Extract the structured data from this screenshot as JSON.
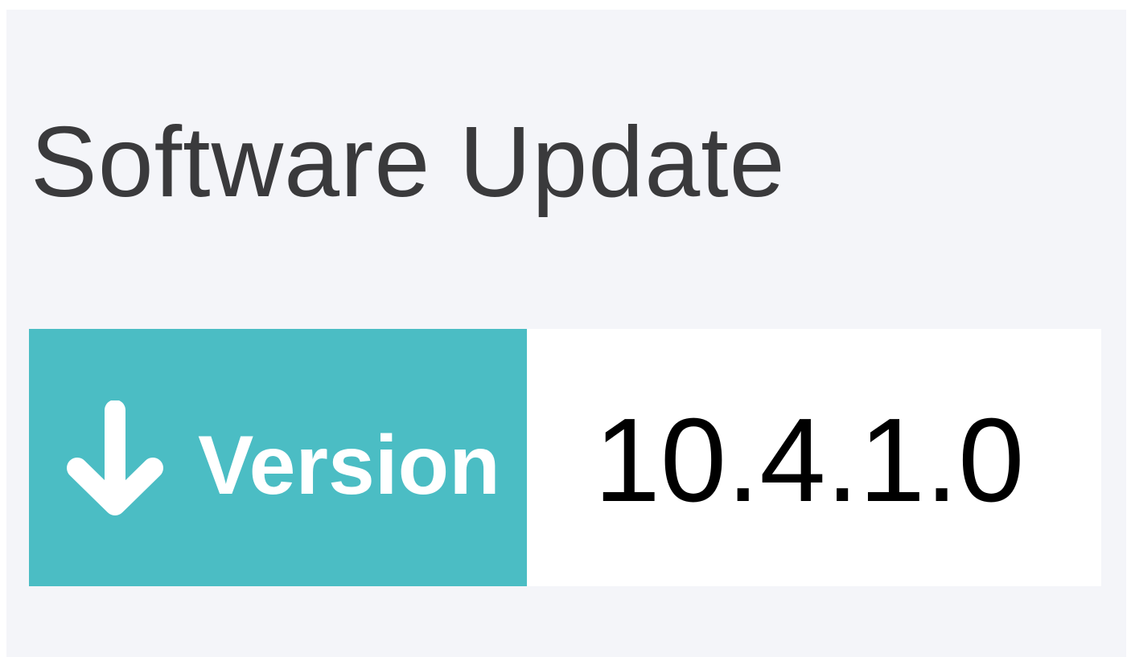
{
  "panel": {
    "title": "Software Update"
  },
  "version": {
    "button_label": "Version",
    "button_icon": "arrow-down-icon",
    "value": "10.4.1.0"
  },
  "colors": {
    "panel_background": "#f4f5f9",
    "accent": "#4bbdc4",
    "title_text": "#3a3a3c"
  }
}
